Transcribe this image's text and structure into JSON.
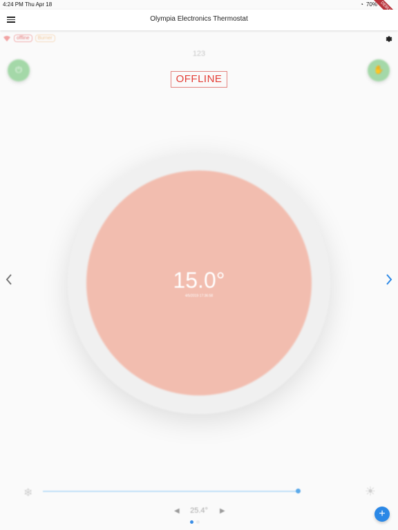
{
  "status_bar": {
    "time": "4:24 PM",
    "date": "Thu Apr 18",
    "battery": "70%"
  },
  "debug_ribbon": "DEBUG",
  "app_bar": {
    "title": "Olympia Electronics Thermostat"
  },
  "badges": {
    "connection": "offline",
    "burner": "Burner"
  },
  "device": {
    "id": "123"
  },
  "connection_state": "OFFLINE",
  "dial": {
    "temperature": "15.0°",
    "timestamp": "4/5/2019 17:36:58"
  },
  "slider": {
    "value_fraction": 0.9
  },
  "setpoint": {
    "value": "25.4°"
  },
  "pager": {
    "count": 2,
    "active": 0
  },
  "fab": {
    "label": "+"
  },
  "colors": {
    "accent": "#2b88e6",
    "offline": "#e33c34",
    "dial": "#f2bdaf"
  }
}
